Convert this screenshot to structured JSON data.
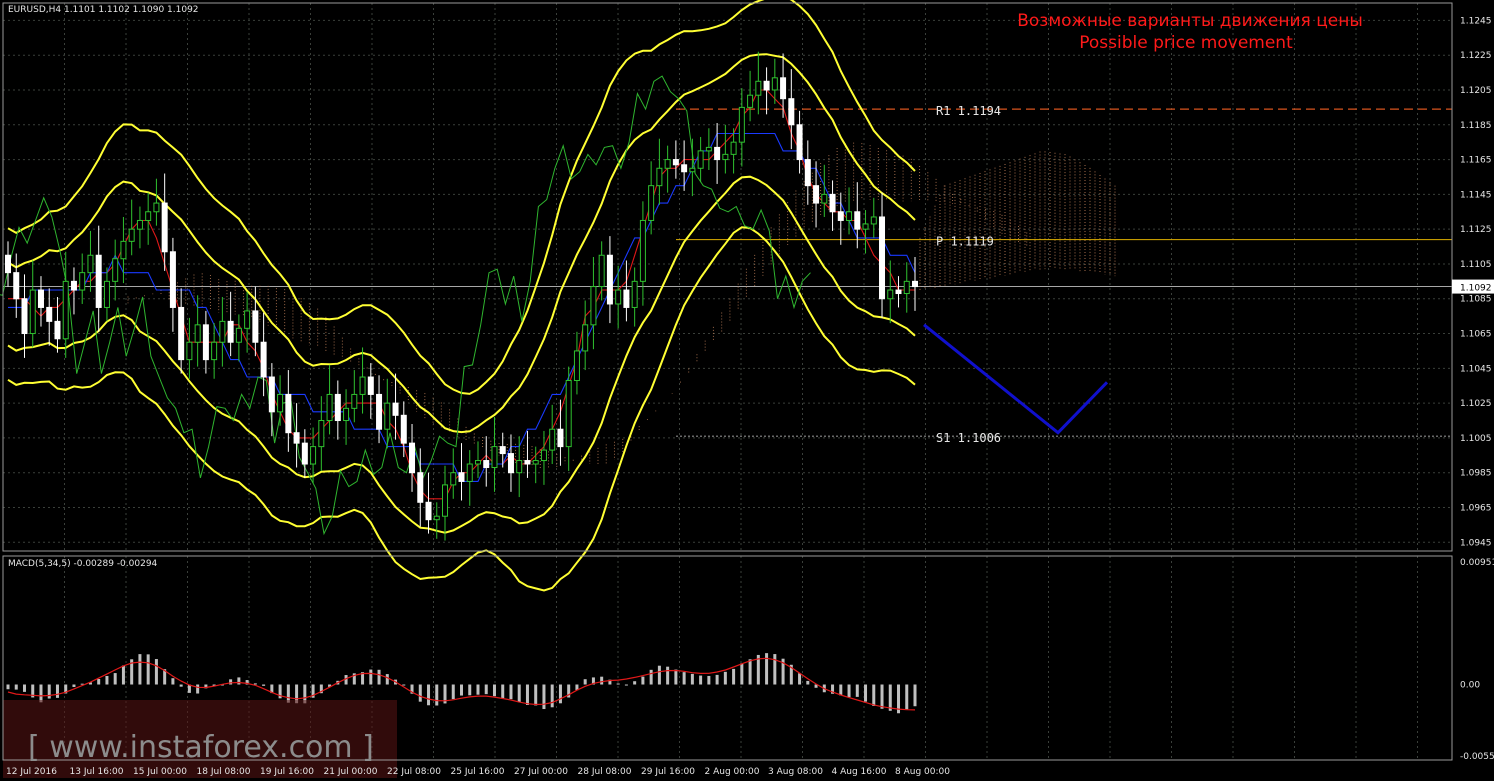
{
  "main_header": "EURUSD,H4  1.1101 1.1102 1.1090 1.1092",
  "annotation": {
    "line1": "Возможные варианты движения цены",
    "line2": "Possible price movement"
  },
  "watermark": "[ www.instaforex.com ]",
  "current_price": "1.1092",
  "levels": [
    {
      "label": "R1 1.1194",
      "price": 1.1194,
      "color": "#d9541e",
      "style": "dash"
    },
    {
      "label": "P 1.1119",
      "price": 1.1119,
      "color": "#e0b000",
      "style": "solid"
    },
    {
      "label": "S1 1.1006",
      "price": 1.1006,
      "color": "#8a8a8a",
      "style": "dot"
    }
  ],
  "macd": {
    "header": "MACD(5,34,5) -0.00289 -0.00294",
    "y_ticks": [
      "0.00951",
      "0.00",
      "-0.00555"
    ],
    "max": 0.00951,
    "min": -0.00555
  },
  "chart_data": [
    {
      "type": "candlestick",
      "symbol": "EURUSD",
      "timeframe": "H4",
      "ylim": [
        1.094,
        1.1255
      ],
      "y_ticks": [
        "1.1245",
        "1.1225",
        "1.1205",
        "1.1185",
        "1.1165",
        "1.1145",
        "1.1125",
        "1.1105",
        "1.1085",
        "1.1065",
        "1.1045",
        "1.1025",
        "1.1005",
        "1.0985",
        "1.0965",
        "1.0945"
      ],
      "x_ticks": [
        "12 Jul 2016",
        "13 Jul 16:00",
        "15 Jul 00:00",
        "18 Jul 08:00",
        "19 Jul 16:00",
        "21 Jul 00:00",
        "22 Jul 08:00",
        "25 Jul 16:00",
        "27 Jul 00:00",
        "28 Jul 08:00",
        "29 Jul 16:00",
        "2 Aug 00:00",
        "3 Aug 08:00",
        "4 Aug 16:00",
        "8 Aug 00:00"
      ],
      "close": [
        1.11,
        1.1085,
        1.1065,
        1.109,
        1.108,
        1.1072,
        1.1062,
        1.1095,
        1.109,
        1.11,
        1.111,
        1.108,
        1.1095,
        1.1108,
        1.1118,
        1.1125,
        1.113,
        1.1135,
        1.114,
        1.1112,
        1.108,
        1.105,
        1.106,
        1.107,
        1.105,
        1.106,
        1.1072,
        1.106,
        1.1068,
        1.1078,
        1.106,
        1.104,
        1.102,
        1.103,
        1.1008,
        1.1002,
        1.099,
        1.1,
        1.1015,
        1.103,
        1.1015,
        1.1022,
        1.103,
        1.104,
        1.103,
        1.101,
        1.1025,
        1.1018,
        1.1002,
        1.0985,
        1.0968,
        1.0958,
        1.096,
        1.0978,
        1.0985,
        1.098,
        1.099,
        1.0992,
        1.0988,
        1.1,
        1.0996,
        1.0985,
        1.0992,
        1.099,
        1.0992,
        1.0998,
        1.101,
        1.1,
        1.1038,
        1.1055,
        1.107,
        1.1092,
        1.111,
        1.1082,
        1.109,
        1.108,
        1.1095,
        1.113,
        1.115,
        1.116,
        1.1165,
        1.1162,
        1.1158,
        1.116,
        1.117,
        1.1172,
        1.1165,
        1.1168,
        1.1175,
        1.1195,
        1.1202,
        1.121,
        1.1205,
        1.1212,
        1.12,
        1.1185,
        1.1165,
        1.115,
        1.114,
        1.1145,
        1.1135,
        1.113,
        1.1135,
        1.1125,
        1.1128,
        1.1132,
        1.1085,
        1.109,
        1.1088,
        1.1095,
        1.1092
      ],
      "bands": {
        "ichimoku_upper_sample": [
          1.112,
          1.115,
          1.1155,
          1.116,
          1.1165,
          1.117,
          1.1168,
          1.116,
          1.115
        ],
        "ichimoku_lower_sample": [
          1.109,
          1.1092,
          1.1095,
          1.1097,
          1.11,
          1.1102,
          1.1102,
          1.11,
          1.1098
        ]
      },
      "forecast_path": [
        {
          "x": "8 Aug 00:00",
          "y": 1.107
        },
        {
          "x": "8 Aug 00:00 +6 bars",
          "y": 1.1008
        },
        {
          "x": "8 Aug 00:00 +11 bars",
          "y": 1.1037
        }
      ]
    }
  ],
  "colors": {
    "grid": "#3a3f3a",
    "bollinger": "#ffff33",
    "tenkan": "#e01818",
    "kijun": "#1a3aff",
    "chikou": "#2fb52f",
    "cloud": "#c0805a",
    "forecast": "#1010cc",
    "macd_hist": "#c0c0c0",
    "macd_signal": "#e01818"
  }
}
